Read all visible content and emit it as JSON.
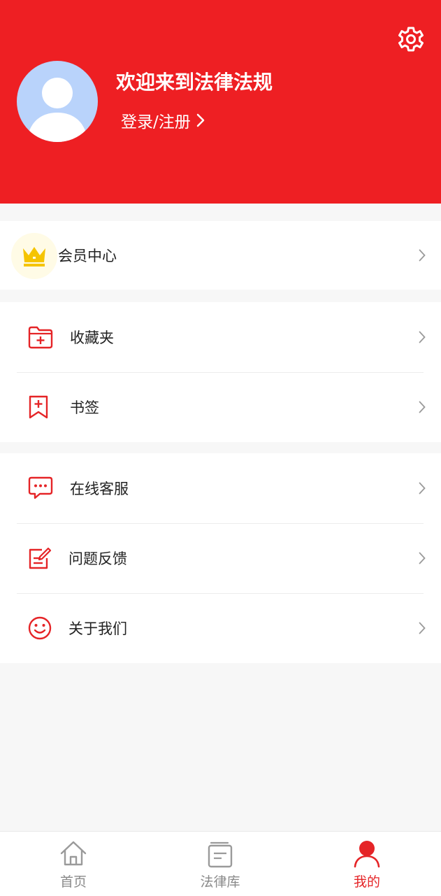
{
  "header": {
    "welcome": "欢迎来到法律法规",
    "login_label": "登录/注册"
  },
  "vip": {
    "label": "会员中心"
  },
  "menu_group_1": [
    {
      "label": "收藏夹",
      "icon": "folder-plus-icon"
    },
    {
      "label": "书签",
      "icon": "bookmark-plus-icon"
    }
  ],
  "menu_group_2": [
    {
      "label": "在线客服",
      "icon": "chat-bubble-icon"
    },
    {
      "label": "问题反馈",
      "icon": "edit-note-icon"
    },
    {
      "label": "关于我们",
      "icon": "smiley-icon"
    }
  ],
  "tabbar": [
    {
      "label": "首页",
      "icon": "home-icon"
    },
    {
      "label": "法律库",
      "icon": "document-library-icon"
    },
    {
      "label": "我的",
      "icon": "user-icon",
      "active": true
    }
  ],
  "colors": {
    "accent": "#ee1f23",
    "icon_red": "#e52427",
    "crown": "#f5c400"
  }
}
